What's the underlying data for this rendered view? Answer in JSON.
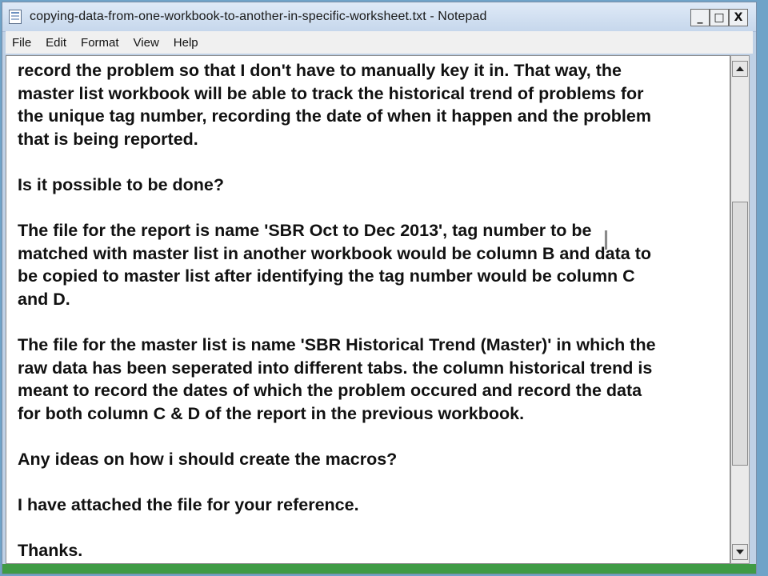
{
  "window": {
    "title": "copying-data-from-one-workbook-to-another-in-specific-worksheet.txt - Notepad",
    "minimize_glyph": "_",
    "maximize_glyph": "□",
    "close_glyph": "X"
  },
  "menubar": {
    "items": [
      {
        "label": "File"
      },
      {
        "label": "Edit"
      },
      {
        "label": "Format"
      },
      {
        "label": "View"
      },
      {
        "label": "Help"
      }
    ]
  },
  "editor": {
    "text": "record the problem so that I don't have to manually key it in. That way, the\nmaster list workbook will be able to track the historical trend of problems for\nthe unique tag number, recording the date of when it happen and the problem\nthat is being reported.\n\nIs it possible to be done?\n\nThe file for the report is name 'SBR Oct to Dec 2013', tag number to be\nmatched with master list in another workbook would be column B and data to\nbe copied to master list after identifying the tag number would be column C\nand D.\n\nThe file for the master list is name 'SBR Historical Trend (Master)' in which the\nraw data has been seperated into different tabs. the column historical trend is\nmeant to record the dates of which the problem occured and record the data\nfor both column C & D of the report in the previous workbook.\n\nAny ideas on how i should create the macros?\n\nI have attached the file for your reference.\n\nThanks."
  },
  "scrollbar": {
    "position_fraction": 0.45
  },
  "icons": {
    "app": "notepad-icon",
    "scroll_up": "arrow-up-icon",
    "scroll_down": "arrow-down-icon"
  }
}
